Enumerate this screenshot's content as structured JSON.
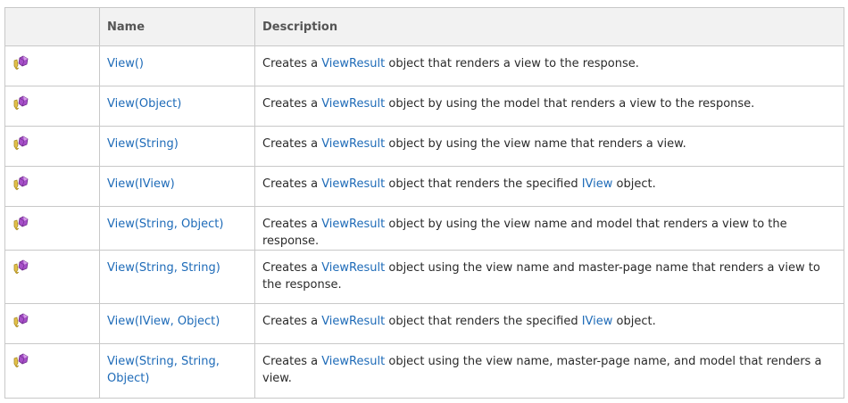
{
  "headers": {
    "icon": "",
    "name": "Name",
    "description": "Description"
  },
  "colors": {
    "link": "#1e6bb8",
    "header_bg": "#f2f2f2",
    "border": "#c8c8c8"
  },
  "rows": [
    {
      "icon": "public-method-icon",
      "name": "View()",
      "desc_pre": "Creates a ",
      "type1": "ViewResult",
      "desc_mid": " object that renders a view to the response.",
      "type2": "",
      "desc_post": ""
    },
    {
      "icon": "public-method-icon",
      "name": "View(Object)",
      "desc_pre": "Creates a ",
      "type1": "ViewResult",
      "desc_mid": " object by using the model that renders a view to the response.",
      "type2": "",
      "desc_post": ""
    },
    {
      "icon": "public-method-icon",
      "name": "View(String)",
      "desc_pre": "Creates a ",
      "type1": "ViewResult",
      "desc_mid": " object by using the view name that renders a view.",
      "type2": "",
      "desc_post": ""
    },
    {
      "icon": "public-method-icon",
      "name": "View(IView)",
      "desc_pre": "Creates a ",
      "type1": "ViewResult",
      "desc_mid": " object that renders the specified ",
      "type2": "IView",
      "desc_post": " object."
    },
    {
      "icon": "public-method-icon",
      "name": "View(String, Object)",
      "desc_pre": "Creates a ",
      "type1": "ViewResult",
      "desc_mid": " object by using the view name and model that renders a view to the response.",
      "type2": "",
      "desc_post": ""
    },
    {
      "icon": "public-method-icon",
      "name": "View(String, String)",
      "desc_pre": "Creates a ",
      "type1": "ViewResult",
      "desc_mid": " object using the view name and master-page name that renders a view to the response.",
      "type2": "",
      "desc_post": ""
    },
    {
      "icon": "public-method-icon",
      "name": "View(IView, Object)",
      "desc_pre": "Creates a ",
      "type1": "ViewResult",
      "desc_mid": " object that renders the specified ",
      "type2": "IView",
      "desc_post": " object."
    },
    {
      "icon": "public-method-icon",
      "name": "View(String, String, Object)",
      "desc_pre": "Creates a ",
      "type1": "ViewResult",
      "desc_mid": " object using the view name, master-page name, and model that renders a view.",
      "type2": "",
      "desc_post": ""
    }
  ]
}
